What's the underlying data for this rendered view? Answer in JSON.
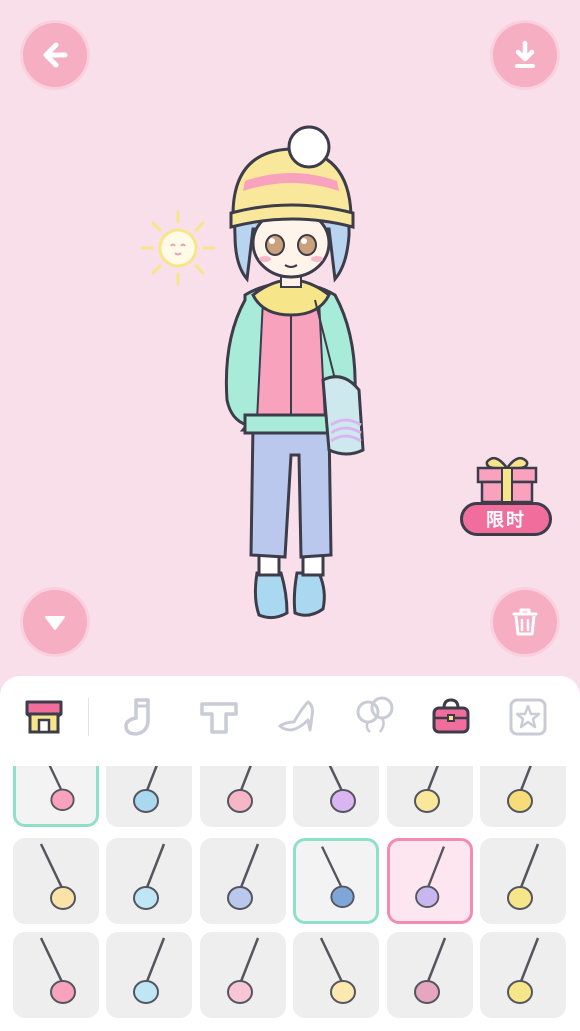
{
  "top_bar": {
    "back_icon": "arrow-left-icon",
    "download_icon": "download-icon"
  },
  "bottom_controls": {
    "collapse_icon": "triangle-down-icon",
    "trash_icon": "trash-icon"
  },
  "promo": {
    "label": "限时",
    "icon": "gift-box-icon"
  },
  "tabs": [
    {
      "name": "shop",
      "icon": "shop-icon",
      "active": true
    },
    {
      "name": "socks",
      "icon": "sock-icon"
    },
    {
      "name": "tops",
      "icon": "shirt-icon"
    },
    {
      "name": "shoes",
      "icon": "high-heel-icon"
    },
    {
      "name": "balloons",
      "icon": "balloon-icon"
    },
    {
      "name": "bags",
      "icon": "bag-icon",
      "selected": true
    },
    {
      "name": "favorites",
      "icon": "star-icon"
    }
  ],
  "items": [
    {
      "icon": "pink-feather-keychain-bag-icon",
      "state": "selected"
    },
    {
      "icon": "blue-charm-bag-icon"
    },
    {
      "icon": "pink-card-bag-icon"
    },
    {
      "icon": "rainbow-heart-bag-icon"
    },
    {
      "icon": "cat-face-bag-icon"
    },
    {
      "icon": "yellow-heart-bag-icon"
    },
    {
      "icon": "bunny-face-bag-icon"
    },
    {
      "icon": "candy-bag-icon"
    },
    {
      "icon": "blue-bow-bag-icon"
    },
    {
      "icon": "blue-tote-bag-icon",
      "state": "selected"
    },
    {
      "icon": "rainbow-phone-bag-icon",
      "state": "equipped"
    },
    {
      "icon": "lemon-heart-bag-icon"
    },
    {
      "icon": "pink-flower-bag-icon"
    },
    {
      "icon": "milk-carton-bag-icon"
    },
    {
      "icon": "bunny-charm-bag-icon"
    },
    {
      "icon": "angel-wing-bag-icon"
    },
    {
      "icon": "bear-face-bag-icon"
    },
    {
      "icon": "shell-bag-icon"
    }
  ],
  "colors": {
    "background": "#f9dfea",
    "button": "#f6aec3",
    "accent_pink": "#f06d9c",
    "select_green": "#8ee0c8",
    "select_pink": "#f48bb0"
  }
}
